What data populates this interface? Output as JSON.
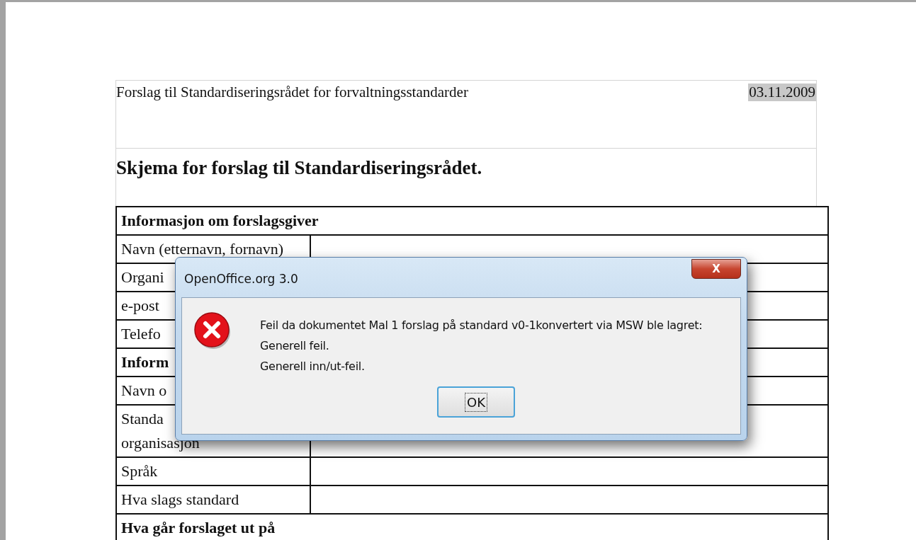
{
  "document": {
    "header_text": "Forslag til Standardiseringsrådet for forvaltningsstandarder",
    "header_date": "03.11.2009",
    "title": "Skjema for forslag til Standardiseringsrådet.",
    "rows": [
      {
        "kind": "section",
        "lines": [
          "Informasjon om forslagsgiver"
        ]
      },
      {
        "kind": "field",
        "lines": [
          "Navn (etternavn, fornavn)"
        ]
      },
      {
        "kind": "field",
        "lines": [
          "Organi"
        ]
      },
      {
        "kind": "field",
        "lines": [
          "e-post"
        ]
      },
      {
        "kind": "field",
        "lines": [
          "Telefo"
        ]
      },
      {
        "kind": "section",
        "lines": [
          "Inform"
        ]
      },
      {
        "kind": "field",
        "lines": [
          "Navn o"
        ]
      },
      {
        "kind": "field",
        "lines": [
          "Standa",
          "organisasjon"
        ]
      },
      {
        "kind": "field",
        "lines": [
          "Språk"
        ]
      },
      {
        "kind": "field",
        "lines": [
          "Hva slags standard"
        ]
      },
      {
        "kind": "section",
        "lines": [
          "Hva går forslaget ut på"
        ]
      }
    ]
  },
  "dialog": {
    "title": "OpenOffice.org 3.0",
    "close": "X",
    "message_lines": [
      "Feil da dokumentet Mal 1 forslag på standard v0-1konvertert via MSW ble lagret:",
      "Generell feil.",
      "Generell inn/ut-feil."
    ],
    "button": "OK"
  }
}
